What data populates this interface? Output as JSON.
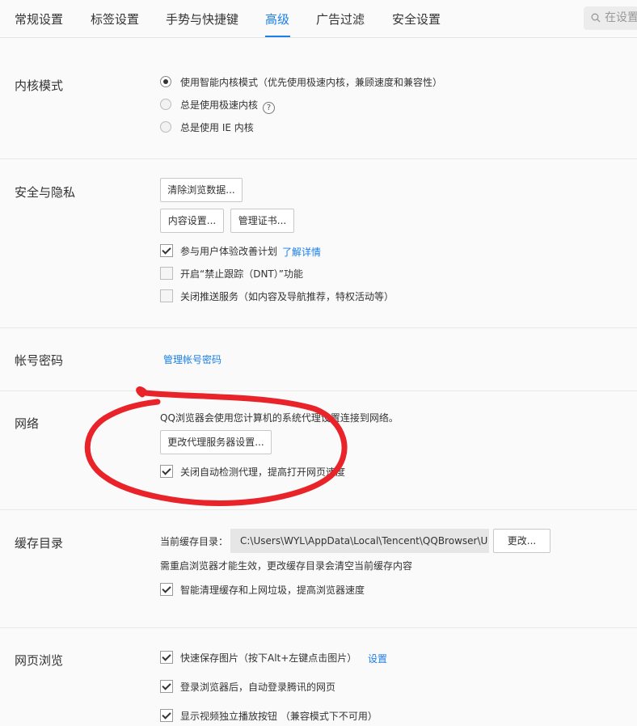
{
  "tabs": [
    {
      "label": "常规设置",
      "active": false
    },
    {
      "label": "标签设置",
      "active": false
    },
    {
      "label": "手势与快捷键",
      "active": false
    },
    {
      "label": "高级",
      "active": true
    },
    {
      "label": "广告过滤",
      "active": false
    },
    {
      "label": "安全设置",
      "active": false
    }
  ],
  "search": {
    "placeholder": "在设置",
    "icon": "search-icon"
  },
  "kernel": {
    "title": "内核模式",
    "options": [
      {
        "label": "使用智能内核模式（优先使用极速内核，兼顾速度和兼容性）",
        "selected": true
      },
      {
        "label": "总是使用极速内核",
        "selected": false,
        "help": "?"
      },
      {
        "label": "总是使用 IE 内核",
        "selected": false
      }
    ]
  },
  "security": {
    "title": "安全与隐私",
    "clear_button": "清除浏览数据...",
    "content_button": "内容设置...",
    "cert_button": "管理证书...",
    "checkboxes": [
      {
        "label": "参与用户体验改善计划",
        "checked": true,
        "link": "了解详情"
      },
      {
        "label": "开启“禁止跟踪（DNT）”功能",
        "checked": false
      },
      {
        "label": "关闭推送服务（如内容及导航推荐，特权活动等）",
        "checked": false
      }
    ]
  },
  "account": {
    "title": "帐号密码",
    "manage_link": "管理帐号密码"
  },
  "network": {
    "title": "网络",
    "description": "QQ浏览器会使用您计算机的系统代理设置连接到网络。",
    "proxy_button": "更改代理服务器设置...",
    "checkbox": {
      "label": "关闭自动检测代理，提高打开网页速度",
      "checked": true
    },
    "annotation_color": "#e8232a"
  },
  "cache": {
    "title": "缓存目录",
    "current_label": "当前缓存目录：",
    "path_value": "C:\\Users\\WYL\\AppData\\Local\\Tencent\\QQBrowser\\U",
    "change_button": "更改...",
    "note": "需重启浏览器才能生效，更改缓存目录会清空当前缓存内容",
    "checkbox": {
      "label": "智能清理缓存和上网垃圾，提高浏览器速度",
      "checked": true
    }
  },
  "browsing": {
    "title": "网页浏览",
    "checkboxes": [
      {
        "label": "快速保存图片（按下Alt+左键点击图片）",
        "checked": true,
        "link": "设置"
      },
      {
        "label": "登录浏览器后，自动登录腾讯的网页",
        "checked": true
      },
      {
        "label": "显示视频独立播放按钮 （兼容模式下不可用）",
        "checked": true
      }
    ]
  },
  "colors": {
    "accent": "#1a7fe8",
    "background": "#fafafa"
  }
}
